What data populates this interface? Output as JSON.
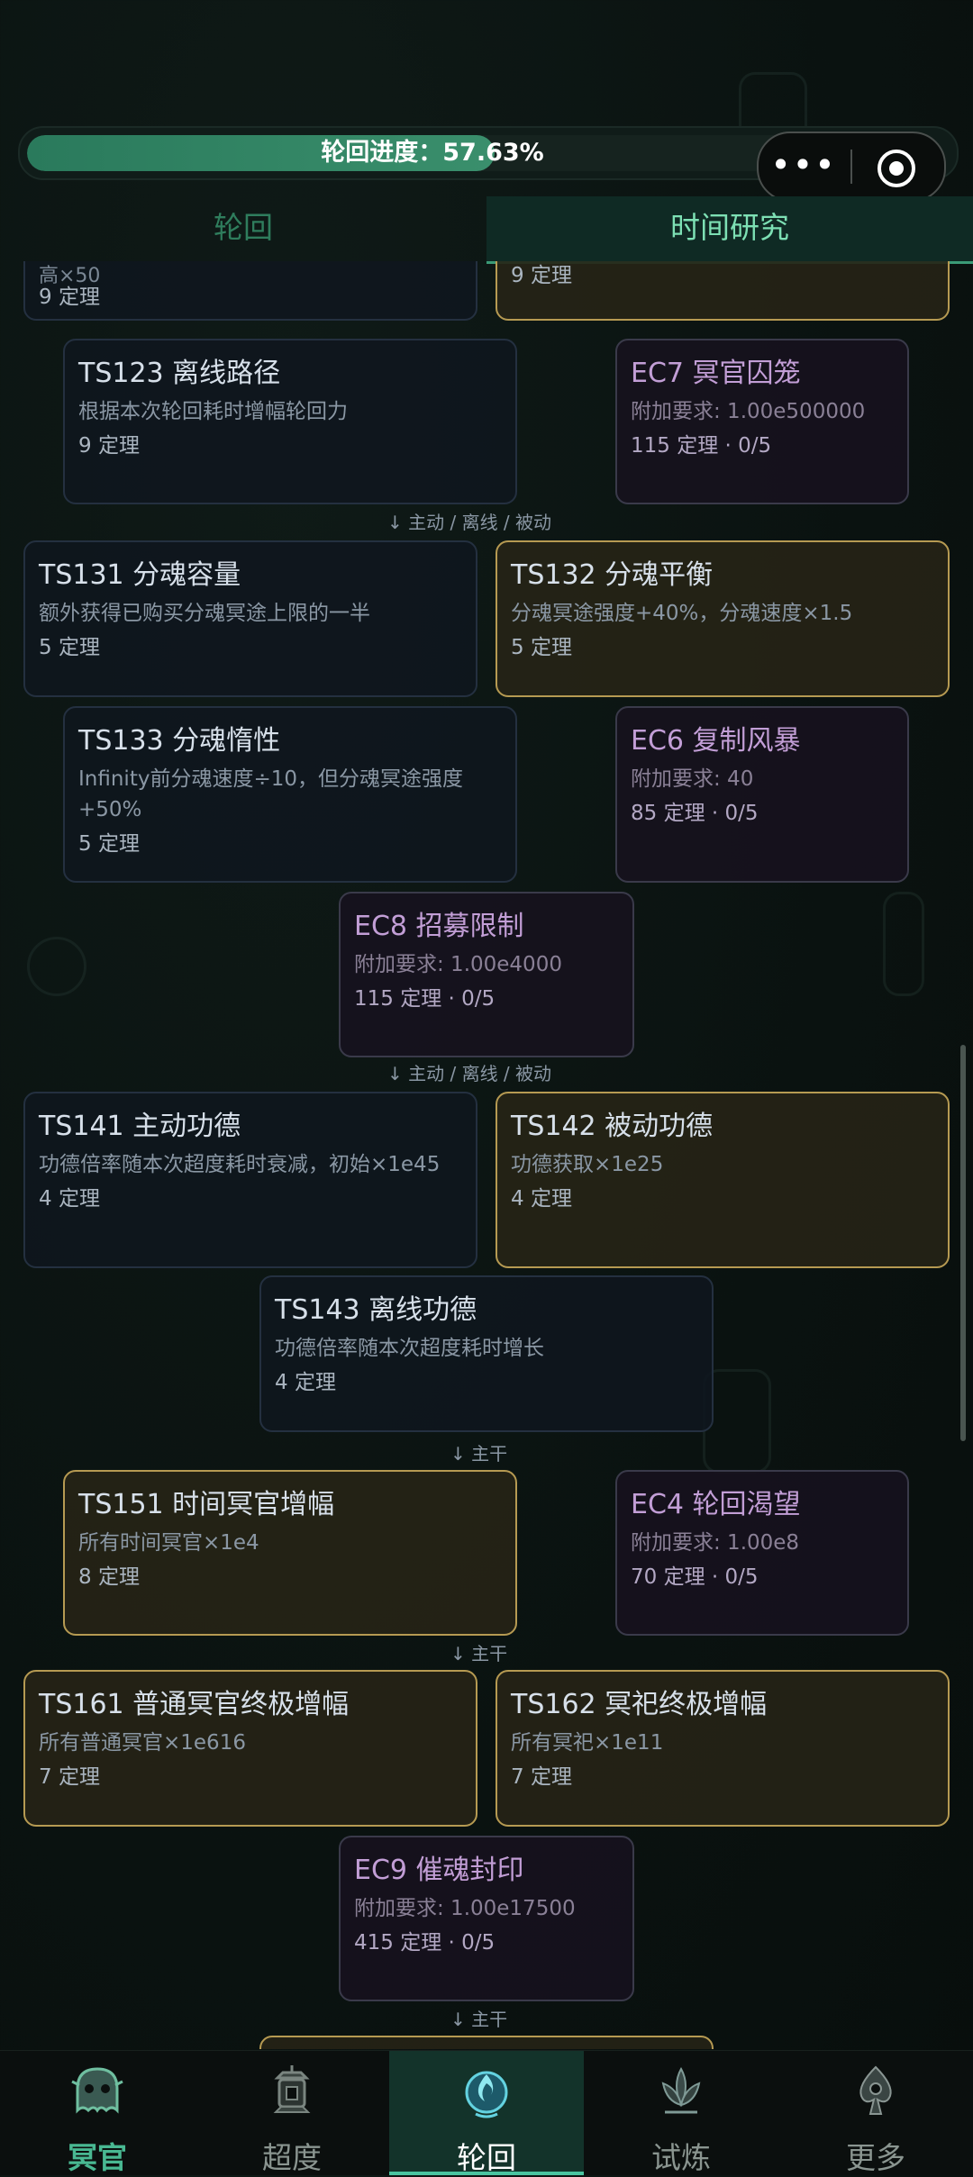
{
  "progress": {
    "text": "轮回进度：57.63%",
    "value": 0.5763
  },
  "capsule": {
    "more_icon": "more-dots-icon",
    "close_icon": "record-circle-icon"
  },
  "tabs": {
    "left": "轮回",
    "right": "时间研究"
  },
  "top_partial": {
    "left_tail": "高×50",
    "left_cost": "9 定理",
    "right_cost": "9 定理"
  },
  "studies": [
    {
      "title": "TS123 离线路径",
      "desc": "根据本次轮回耗时增幅轮回力",
      "cost": "9 定理"
    },
    {
      "title": "EC7 冥官囚笼",
      "desc": "附加要求: 1.00e500000",
      "cost": "115 定理 · 0/5"
    },
    {
      "title": "TS131 分魂容量",
      "desc": "额外获得已购买分魂冥途上限的一半",
      "cost": "5 定理"
    },
    {
      "title": "TS132 分魂平衡",
      "desc": "分魂冥途强度+40%，分魂速度×1.5",
      "cost": "5 定理"
    },
    {
      "title": "TS133 分魂惰性",
      "desc": "Infinity前分魂速度÷10，但分魂冥途强度+50%",
      "cost": "5 定理"
    },
    {
      "title": "EC6 复制风暴",
      "desc": "附加要求: 40",
      "cost": "85 定理 · 0/5"
    },
    {
      "title": "EC8 招募限制",
      "desc": "附加要求: 1.00e4000",
      "cost": "115 定理 · 0/5"
    },
    {
      "title": "TS141 主动功德",
      "desc": "功德倍率随本次超度耗时衰减，初始×1e45",
      "cost": "4 定理"
    },
    {
      "title": "TS142 被动功德",
      "desc": "功德获取×1e25",
      "cost": "4 定理"
    },
    {
      "title": "TS143 离线功德",
      "desc": "功德倍率随本次超度耗时增长",
      "cost": "4 定理"
    },
    {
      "title": "TS151 时间冥官增幅",
      "desc": "所有时间冥官×1e4",
      "cost": "8 定理"
    },
    {
      "title": "EC4 轮回渴望",
      "desc": "附加要求: 1.00e8",
      "cost": "70 定理 · 0/5"
    },
    {
      "title": "TS161 普通冥官终极增幅",
      "desc": "所有普通冥官×1e616",
      "cost": "7 定理"
    },
    {
      "title": "TS162 冥祀终极增幅",
      "desc": "所有冥祀×1e11",
      "cost": "7 定理"
    },
    {
      "title": "EC9 催魂封印",
      "desc": "附加要求: 1.00e17500",
      "cost": "415 定理 · 0/5"
    }
  ],
  "connectors": [
    "↓  主动 / 离线 / 被动",
    "↓  主动 / 离线 / 被动",
    "↓  主干",
    "↓  主干",
    "↓  主干"
  ],
  "nav": [
    {
      "label": "冥官",
      "icon": "ghost-mask-icon"
    },
    {
      "label": "超度",
      "icon": "lantern-shrine-icon"
    },
    {
      "label": "轮回",
      "icon": "spirit-flame-icon"
    },
    {
      "label": "试炼",
      "icon": "lotus-icon"
    },
    {
      "label": "更多",
      "icon": "spade-emblem-icon"
    }
  ],
  "colors": {
    "accent": "#49c4a0",
    "selected_border": "#b69a52",
    "ec_title": "#c29ed6",
    "progress_fill": "#2a7a5c"
  }
}
